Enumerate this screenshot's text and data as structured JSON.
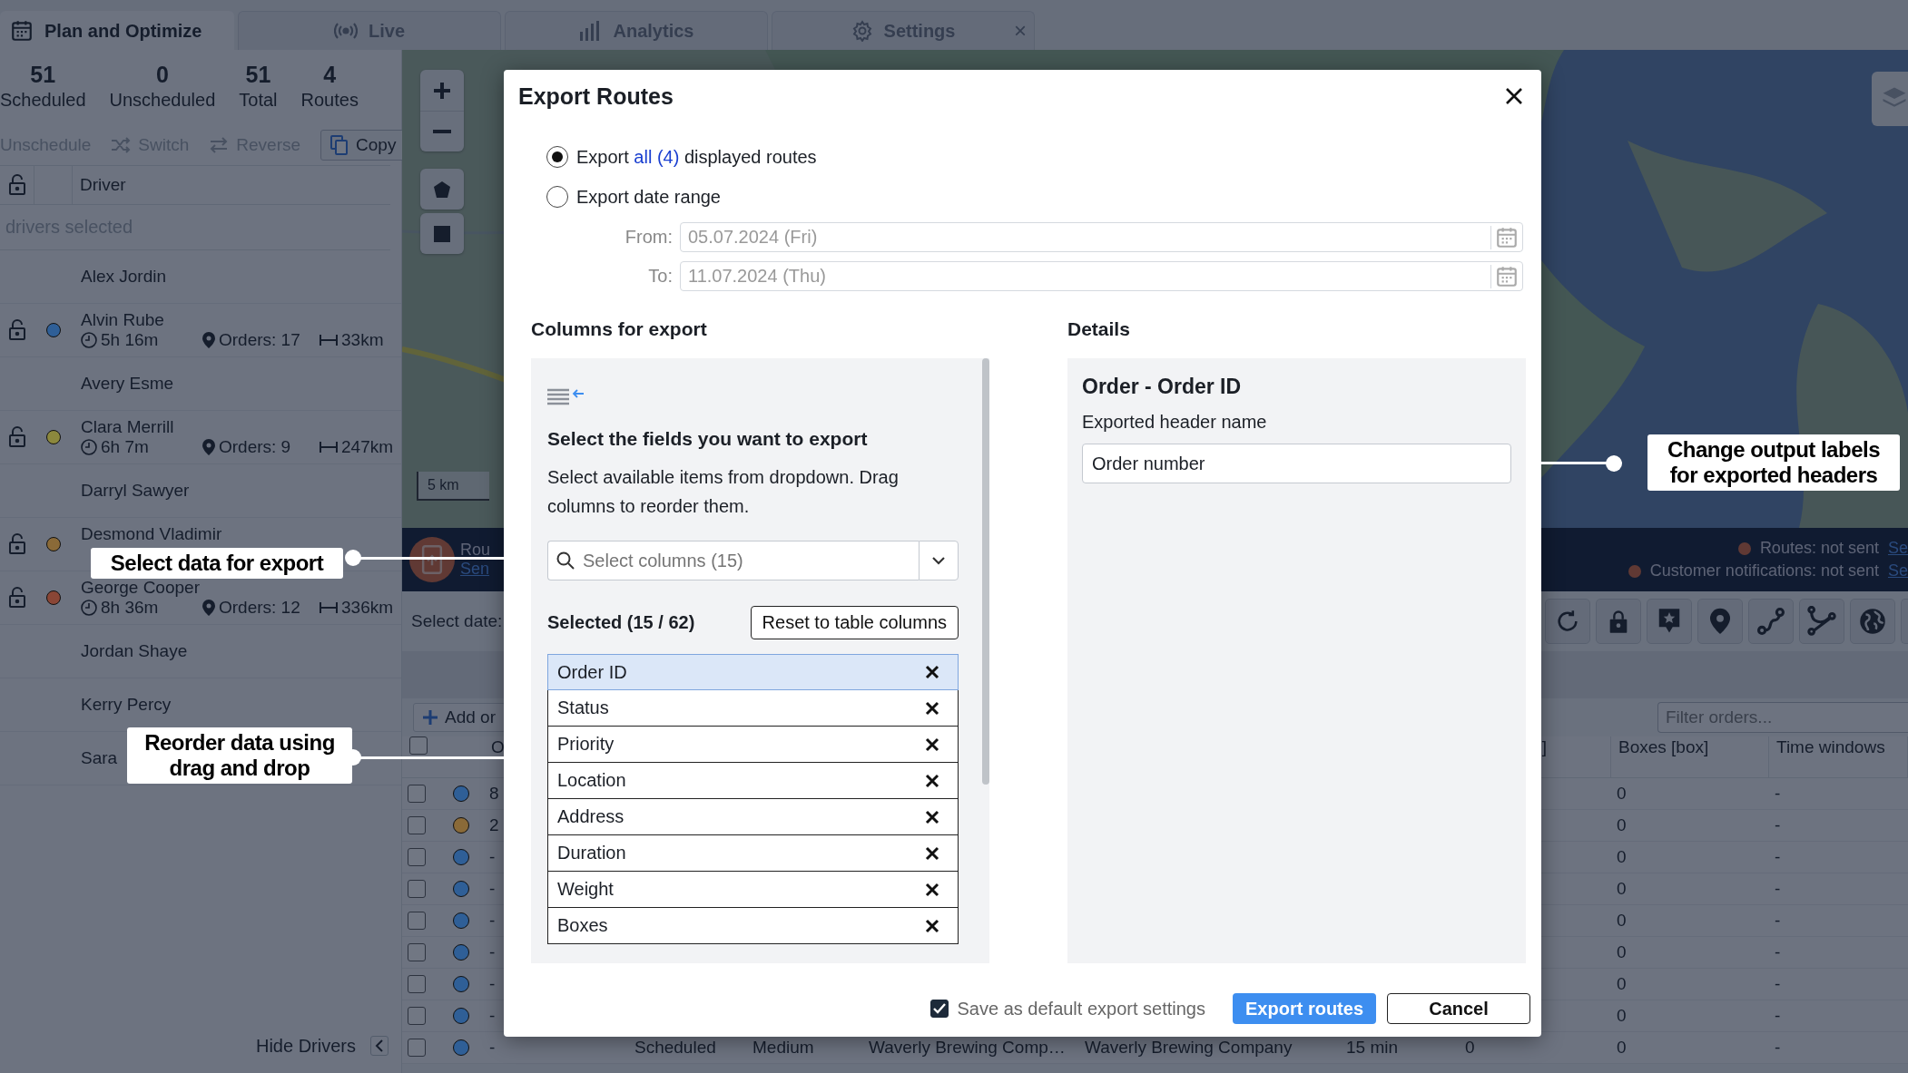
{
  "tabs": [
    {
      "label": "Plan and Optimize",
      "selected": true
    },
    {
      "label": "Live",
      "selected": false
    },
    {
      "label": "Analytics",
      "selected": false
    },
    {
      "label": "Settings",
      "selected": false,
      "close": "×"
    }
  ],
  "stats": [
    {
      "value": "51",
      "label": "Scheduled"
    },
    {
      "value": "0",
      "label": "Unscheduled"
    },
    {
      "value": "51",
      "label": "Total"
    },
    {
      "value": "4",
      "label": "Routes"
    }
  ],
  "driver_toolbar": [
    {
      "label": "Unschedule",
      "disabled": true
    },
    {
      "label": "Switch",
      "disabled": true
    },
    {
      "label": "Reverse",
      "disabled": true
    },
    {
      "label": "Copy",
      "disabled": false
    }
  ],
  "drivers_table": {
    "column": "Driver",
    "filter": "drivers selected",
    "drivers": [
      {
        "name": "Alex Jordin"
      },
      {
        "name": "Alvin Rube",
        "color": "#2f5f97",
        "time": "5h 16m",
        "orders": "Orders: 17",
        "distance": "33km"
      },
      {
        "name": "Avery Esme"
      },
      {
        "name": "Clara Merrill",
        "color": "#8c883d",
        "time": "6h 7m",
        "orders": "Orders: 9",
        "distance": "247km"
      },
      {
        "name": "Darryl Sawyer"
      },
      {
        "name": "Desmond Vladimir",
        "color": "#8a6a38"
      },
      {
        "name": "George Cooper",
        "color": "#8a4636",
        "time": "8h 36m",
        "orders": "Orders: 12",
        "distance": "336km"
      },
      {
        "name": "Jordan Shaye"
      },
      {
        "name": "Kerry Percy"
      },
      {
        "name": "Sara"
      }
    ]
  },
  "hide_drivers": "Hide Drivers",
  "map": {
    "scale": "5 km"
  },
  "notification_bar": {
    "title": "Rou",
    "link": "Sen",
    "statuses": [
      {
        "label": "Routes: not sent",
        "link": "Se"
      },
      {
        "label": "Customer notifications: not sent",
        "link": "Se"
      }
    ]
  },
  "orders": {
    "date_label": "Select date:",
    "add_button": "Add or",
    "filter_placeholder": "Filter orders...",
    "header_checked": false,
    "header": {
      "column_3": "O",
      "column_9": "]",
      "boxes": "Boxes [box]",
      "time_windows": "Time windows"
    },
    "rows": [
      {
        "checked": false,
        "color": "#2f5f97",
        "column_3": "8",
        "boxes": "0",
        "time_windows": "-"
      },
      {
        "checked": false,
        "color": "#8a6a38",
        "column_3": "2",
        "boxes": "0",
        "time_windows": "-"
      },
      {
        "checked": false,
        "color": "#2f5f97",
        "column_3": "-",
        "boxes": "0",
        "time_windows": "-"
      },
      {
        "checked": false,
        "color": "#2f5f97",
        "column_3": "-",
        "boxes": "0",
        "time_windows": "-"
      },
      {
        "checked": false,
        "color": "#2f5f97",
        "column_3": "-",
        "boxes": "0",
        "time_windows": "-"
      },
      {
        "checked": false,
        "color": "#2f5f97",
        "column_3": "-",
        "boxes": "0",
        "time_windows": "-"
      },
      {
        "checked": false,
        "color": "#2f5f97",
        "column_3": "-",
        "boxes": "0",
        "time_windows": "-"
      },
      {
        "checked": false,
        "color": "#2f5f97",
        "column_3": "-",
        "boxes": "0",
        "time_windows": "-"
      },
      {
        "checked": false,
        "color": "#2f5f97",
        "column_3": "-",
        "column_4": "Scheduled",
        "column_5": "Medium",
        "column_6": "Waverly Brewing Comp…",
        "column_7": "Waverly Brewing Company",
        "column_8": "15 min",
        "column_9": "0",
        "boxes": "0",
        "time_windows": "-"
      }
    ]
  },
  "dialog": {
    "title": "Export Routes",
    "options": [
      {
        "prefix": "Export ",
        "link": "all (4)",
        "suffix": " displayed routes",
        "selected": true
      },
      {
        "prefix": "Export date range",
        "selected": false
      }
    ],
    "dates": [
      {
        "label": "From:",
        "value": "05.07.2024 (Fri)",
        "disabled": true
      },
      {
        "label": "To:",
        "value": "11.07.2024 (Thu)",
        "disabled": true
      }
    ],
    "columns_heading": "Columns for export",
    "help_title": "Select the fields you want to export",
    "help_text": "Select available items from dropdown. Drag columns to reorder them.",
    "select_placeholder": "Select columns (15)",
    "selected_count": "Selected (15 / 62)",
    "reset_button": "Reset to table columns",
    "column_items": [
      {
        "label": "Order ID",
        "selected": true
      },
      {
        "label": "Status",
        "selected": false
      },
      {
        "label": "Priority",
        "selected": false
      },
      {
        "label": "Location",
        "selected": false
      },
      {
        "label": "Address",
        "selected": false
      },
      {
        "label": "Duration",
        "selected": false
      },
      {
        "label": "Weight",
        "selected": false
      },
      {
        "label": "Boxes",
        "selected": false
      }
    ],
    "details_heading": "Details",
    "details_title": "Order - Order ID",
    "header_label": "Exported header name",
    "header_value": "Order number",
    "save_default": {
      "label": "Save as default export settings",
      "checked": true
    },
    "export_button": "Export routes",
    "cancel_button": "Cancel"
  },
  "callouts": [
    {
      "text": "Select data for export"
    },
    {
      "text": "Reorder data using drag and drop"
    },
    {
      "text": "Change output labels for exported headers"
    }
  ]
}
